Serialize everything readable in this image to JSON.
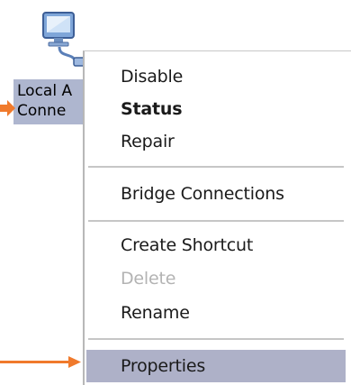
{
  "desktop": {
    "icon_name": "network-connection-icon",
    "label_line1": "Local A",
    "label_line2": "Conne"
  },
  "menu": {
    "items": [
      {
        "label": "Disable",
        "state": "normal"
      },
      {
        "label": "Status",
        "state": "default-bold"
      },
      {
        "label": "Repair",
        "state": "normal"
      },
      {
        "label": "Bridge Connections",
        "state": "normal"
      },
      {
        "label": "Create Shortcut",
        "state": "normal"
      },
      {
        "label": "Delete",
        "state": "disabled"
      },
      {
        "label": "Rename",
        "state": "normal"
      },
      {
        "label": "Properties",
        "state": "highlighted"
      }
    ]
  },
  "colors": {
    "arrow": "#f07a2c",
    "highlight": "#aeb1c8",
    "label_selection": "#aeb6cf",
    "disabled_text": "#b3b3b3"
  }
}
